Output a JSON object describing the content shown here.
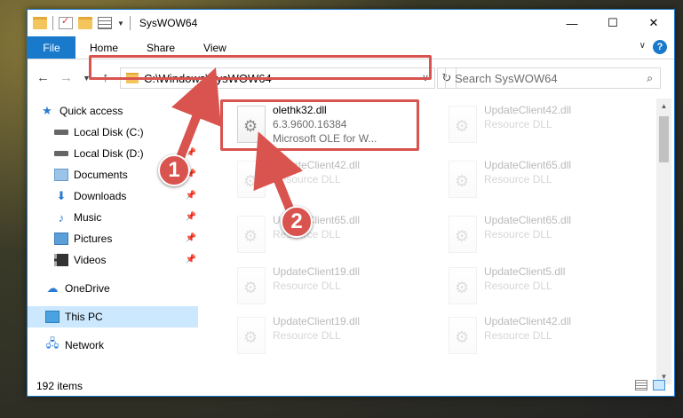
{
  "window": {
    "title": "SysWOW64",
    "controls": {
      "minimize": "—",
      "maximize": "☐",
      "close": "✕"
    }
  },
  "ribbon": {
    "tabs": [
      "File",
      "Home",
      "Share",
      "View"
    ],
    "help": "?"
  },
  "address": {
    "path": "C:\\Windows\\SysWOW64",
    "search_placeholder": "Search SysWOW64"
  },
  "nav": {
    "items": [
      {
        "label": "Quick access",
        "icon": "star-icon",
        "pinned": false
      },
      {
        "label": "Local Disk (C:)",
        "icon": "disk-icon",
        "pinned": false
      },
      {
        "label": "Local Disk (D:)",
        "icon": "disk-icon",
        "pinned": true
      },
      {
        "label": "Documents",
        "icon": "documents-icon",
        "pinned": true
      },
      {
        "label": "Downloads",
        "icon": "downloads-icon",
        "pinned": true
      },
      {
        "label": "Music",
        "icon": "music-icon",
        "pinned": true
      },
      {
        "label": "Pictures",
        "icon": "pictures-icon",
        "pinned": true
      },
      {
        "label": "Videos",
        "icon": "videos-icon",
        "pinned": true
      },
      {
        "label": "OneDrive",
        "icon": "cloud-icon",
        "pinned": false
      },
      {
        "label": "This PC",
        "icon": "computer-icon",
        "pinned": false
      },
      {
        "label": "Network",
        "icon": "network-icon",
        "pinned": false
      }
    ]
  },
  "files": [
    {
      "name": "olethk32.dll",
      "meta1": "6.3.9600.16384",
      "meta2": "Microsoft OLE for W...",
      "highlight": true
    },
    {
      "name": "UpdateClient42.dll",
      "meta1": "Resource DLL"
    },
    {
      "name": "UpdateClient42.dll",
      "meta1": "Resource DLL"
    },
    {
      "name": "UpdateClient65.dll",
      "meta1": "Resource DLL"
    },
    {
      "name": "UpdateClient65.dll",
      "meta1": "Resource DLL"
    },
    {
      "name": "UpdateClient65.dll",
      "meta1": "Resource DLL"
    },
    {
      "name": "UpdateClient19.dll",
      "meta1": "Resource DLL"
    },
    {
      "name": "UpdateClient5.dll",
      "meta1": "Resource DLL"
    },
    {
      "name": "UpdateClient19.dll",
      "meta1": "Resource DLL"
    },
    {
      "name": "UpdateClient42.dll",
      "meta1": "Resource DLL"
    }
  ],
  "status": {
    "item_count": "192 items"
  },
  "callouts": [
    "1",
    "2"
  ],
  "colors": {
    "accent": "#1979ca",
    "highlight_red": "#d9534f",
    "selection": "#cce8ff"
  }
}
